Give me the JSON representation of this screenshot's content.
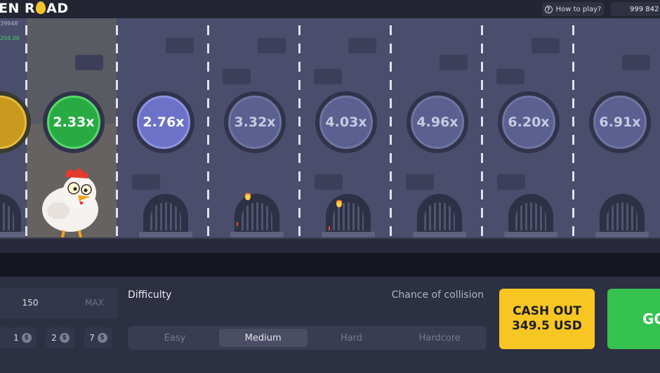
{
  "header": {
    "logo_left": "EN R",
    "logo_right": "AD",
    "logo_egg_icon": "egg-icon",
    "how_to_play": "How to play?",
    "balance": "999 842"
  },
  "stats": {
    "line1": "39948",
    "line2": "204.00"
  },
  "multipliers": [
    "2.33x",
    "2.76x",
    "3.32x",
    "4.03x",
    "4.96x",
    "6.20x",
    "6.91x"
  ],
  "controls": {
    "bet_value": "150",
    "bet_max": "MAX",
    "quick_bets": [
      "1",
      "2",
      "7"
    ],
    "difficulty_label": "Difficulty",
    "chance_label": "Chance of collision",
    "difficulty_options": [
      "Easy",
      "Medium",
      "Hard",
      "Hardcore"
    ],
    "selected_difficulty": "Medium",
    "cashout_line1": "CASH OUT",
    "cashout_line2": "349.5 USD",
    "go_label": "GO"
  },
  "colors": {
    "accent_gold": "#f7c623",
    "accent_green": "#35c24f",
    "lane_bg": "#4a4d6b"
  }
}
